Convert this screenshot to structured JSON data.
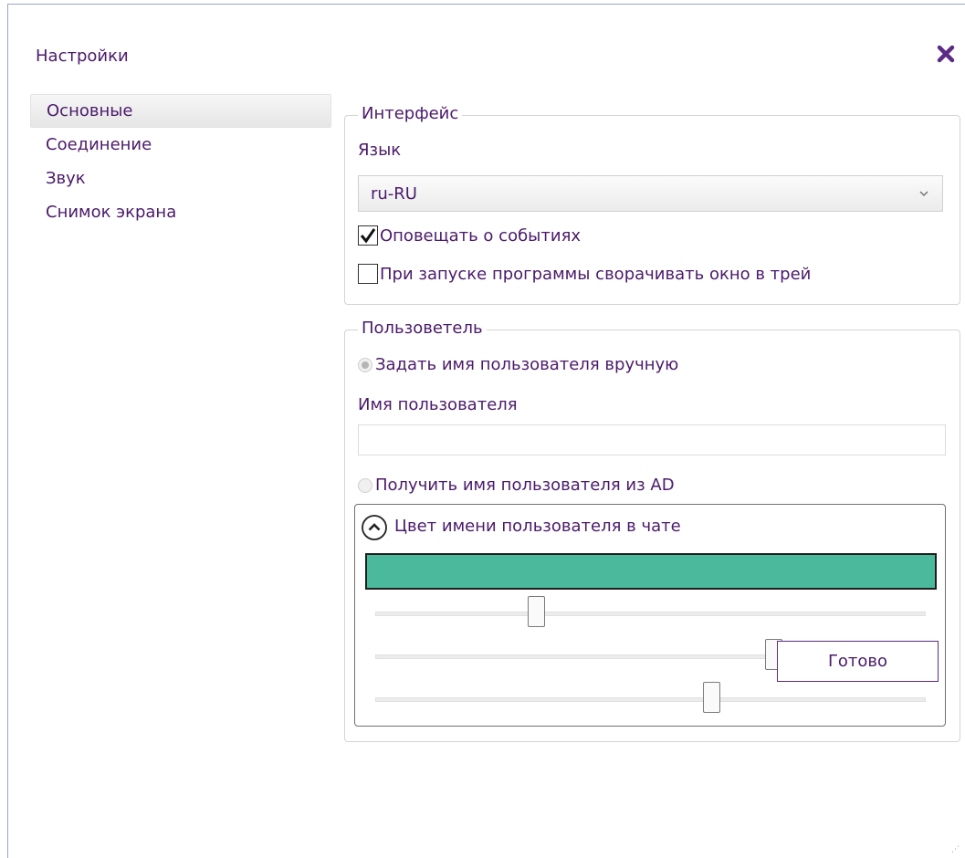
{
  "window": {
    "title": "Настройки"
  },
  "sidebar": {
    "items": [
      {
        "label": "Основные",
        "active": true
      },
      {
        "label": "Соединение",
        "active": false
      },
      {
        "label": "Звук",
        "active": false
      },
      {
        "label": "Снимок экрана",
        "active": false
      }
    ]
  },
  "interface": {
    "legend": "Интерфейс",
    "language_label": "Язык",
    "language_value": "ru-RU",
    "notify_label": "Оповещать о событиях",
    "notify_checked": true,
    "minimize_label": "При запуске программы сворачивать окно в трей",
    "minimize_checked": false
  },
  "user": {
    "legend": "Пользоветель",
    "manual_label": "Задать имя пользователя вручную",
    "manual_selected": true,
    "username_label": "Имя пользователя",
    "username_value": "",
    "ad_label": "Получить имя пользователя из AD",
    "ad_selected": false,
    "color_header": "Цвет имени пользователя в чате",
    "color_hex": "#4bb99c",
    "sliders": [
      {
        "channel": "R",
        "value": 75,
        "max": 255
      },
      {
        "channel": "G",
        "value": 185,
        "max": 255
      },
      {
        "channel": "B",
        "value": 156,
        "max": 255
      }
    ]
  },
  "footer": {
    "done_label": "Готово"
  },
  "colors": {
    "text": "#4b1a6b",
    "close_icon": "#5b2b85",
    "button_border": "#5c2c82"
  },
  "icons": {
    "close": "close-icon",
    "combo_arrow": "chevron-down-icon",
    "expander": "chevron-up-icon",
    "check": "checkmark-icon"
  }
}
